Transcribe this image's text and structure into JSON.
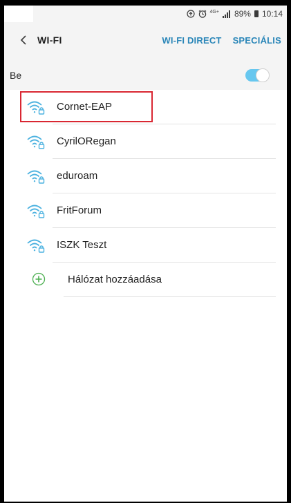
{
  "status_bar": {
    "network_label": "4G+",
    "battery": "89%",
    "time": "10:14"
  },
  "header": {
    "title": "WI-FI",
    "wifi_direct": "WI-FI DIRECT",
    "special": "SPECIÁLIS"
  },
  "toggle": {
    "label": "Be",
    "state": "on"
  },
  "colors": {
    "accent": "#2a86b8",
    "toggle_on": "#67c7ef",
    "wifi_icon": "#4cb2e0",
    "highlight_box": "#d92732",
    "add_icon": "#4caf50"
  },
  "networks": [
    {
      "name": "Cornet-EAP",
      "icon": "wifi-locked-icon",
      "highlighted": true
    },
    {
      "name": "CyrilORegan",
      "icon": "wifi-locked-icon"
    },
    {
      "name": "eduroam",
      "icon": "wifi-locked-icon"
    },
    {
      "name": "FritForum",
      "icon": "wifi-locked-icon"
    },
    {
      "name": "ISZK Teszt",
      "icon": "wifi-locked-icon"
    }
  ],
  "add_network": {
    "label": "Hálózat hozzáadása",
    "icon": "plus-circle-icon"
  }
}
